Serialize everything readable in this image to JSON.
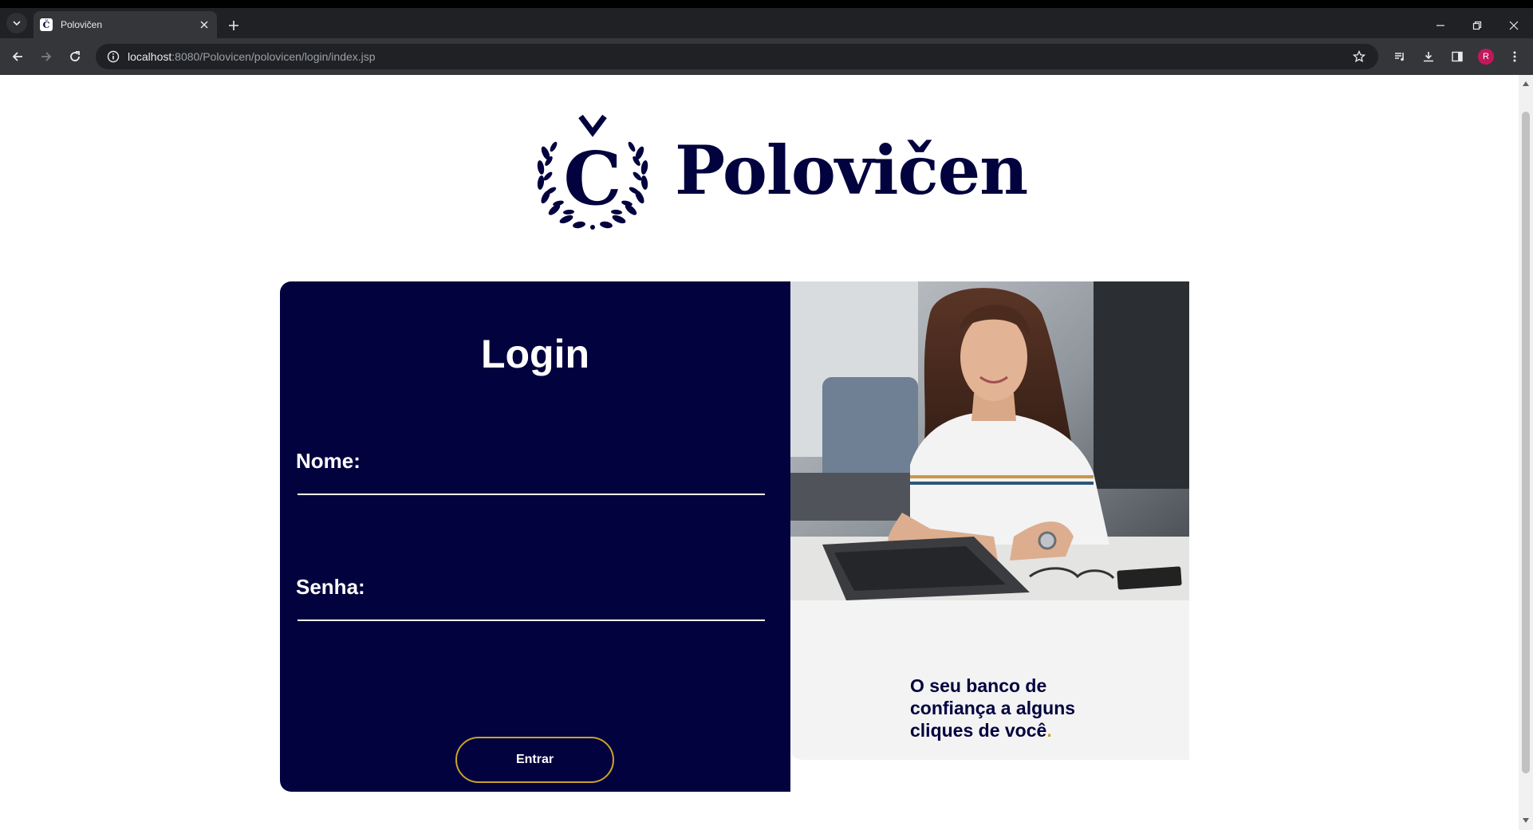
{
  "browser": {
    "tab_title": "Polovičen",
    "url_host": "localhost",
    "url_rest": ":8080/Polovicen/polovicen/login/index.jsp",
    "profile_initial": "R"
  },
  "brand": {
    "emblem_letter": "Č",
    "name": "Polovičen"
  },
  "login": {
    "title": "Login",
    "name_label": "Nome:",
    "name_value": "",
    "password_label": "Senha:",
    "password_value": "",
    "submit_label": "Entrar"
  },
  "side": {
    "tagline": "O seu banco de confiança a alguns cliques de você",
    "tagline_end": "."
  },
  "colors": {
    "navy": "#02023e",
    "gold": "#c9a227",
    "panel_gray": "#f3f3f4"
  },
  "icons": [
    "tab-search-icon",
    "close-icon",
    "plus-icon",
    "minimize-icon",
    "restore-icon",
    "back-icon",
    "forward-icon",
    "reload-icon",
    "info-icon",
    "star-icon",
    "media-icon",
    "download-icon",
    "sidepanel-icon",
    "menu-icon"
  ]
}
